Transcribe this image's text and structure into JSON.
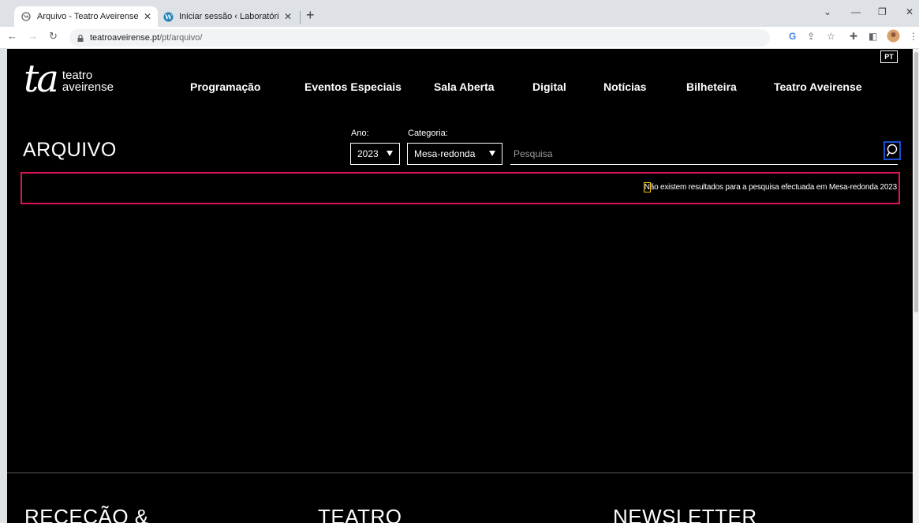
{
  "browser": {
    "tabs": [
      {
        "title": "Arquivo - Teatro Aveirense",
        "active": true
      },
      {
        "title": "Iniciar sessão ‹ Laboratório de Ac",
        "active": false
      }
    ],
    "url_host": "teatroaveirense.pt",
    "url_path": "/pt/arquivo/",
    "new_tab": "+",
    "min": "—",
    "restore": "❐",
    "close": "✕",
    "chevron": "⌄"
  },
  "site": {
    "logo_mark": "ta",
    "logo_line1": "teatro",
    "logo_line2": "aveirense",
    "lang": "PT",
    "nav": [
      "Programação",
      "Eventos Especiais",
      "Sala Aberta",
      "Digital",
      "Notícias",
      "Bilheteira",
      "Teatro Aveirense"
    ]
  },
  "archive": {
    "title": "ARQUIVO",
    "year_label": "Ano:",
    "year_value": "2023",
    "category_label": "Categoria:",
    "category_value": "Mesa-redonda",
    "search_placeholder": "Pesquisa",
    "result_first_letter": "N",
    "result_rest": "ão existem resultados para a pesquisa efectuada em Mesa-redonda 2023"
  },
  "footer": {
    "headings": [
      "RECEÇÃO &",
      "TEATRO",
      "NEWSLETTER"
    ]
  },
  "colors": {
    "highlight_border": "#e0115f",
    "focus_outline": "#1a4fd6",
    "letter_outline": "#f0c419"
  }
}
